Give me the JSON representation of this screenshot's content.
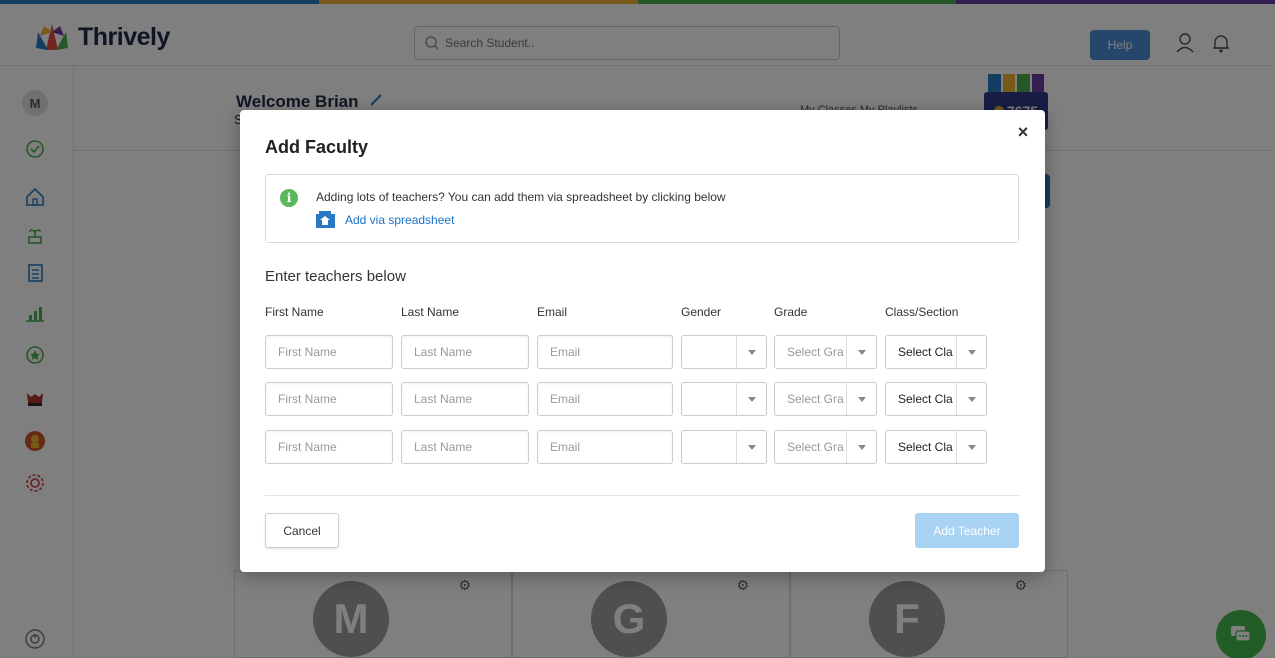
{
  "app": {
    "brand": "Thrively",
    "search_placeholder": "Search Student..",
    "help_label": "Help",
    "colors": {
      "rainbow": [
        "#2b79c2",
        "#f2b233",
        "#4caf50",
        "#6a3fa0"
      ],
      "accent": "#2b79c2"
    }
  },
  "sidebar": {
    "avatar_letter": "M",
    "icons": [
      "check-circle-icon",
      "home-icon",
      "plant-icon",
      "list-icon",
      "chart-icon",
      "star-badge-icon",
      "mascot-icon",
      "character-icon",
      "settings-icon",
      "power-icon"
    ]
  },
  "background": {
    "welcome": "Welcome Brian",
    "subtitle_initial": "S",
    "tabs": "My Classes    My Playlists",
    "points": "7675",
    "card_letters": [
      "M",
      "G",
      "F"
    ]
  },
  "modal": {
    "title": "Add Faculty",
    "close_glyph": "×",
    "info_text": "Adding lots of teachers? You can add them via spreadsheet by clicking below",
    "spreadsheet_link": "Add via spreadsheet",
    "section_heading": "Enter teachers below",
    "columns": {
      "first_name": "First Name",
      "last_name": "Last Name",
      "email": "Email",
      "gender": "Gender",
      "grade": "Grade",
      "class_section": "Class/Section"
    },
    "placeholders": {
      "first_name": "First Name",
      "last_name": "Last Name",
      "email": "Email"
    },
    "rows": [
      {
        "gender": "",
        "grade": "Select Gra",
        "class": "Select Cla"
      },
      {
        "gender": "",
        "grade": "Select Gra",
        "class": "Select Cla"
      },
      {
        "gender": "",
        "grade": "Select Gra",
        "class": "Select Cla"
      }
    ],
    "cancel_label": "Cancel",
    "submit_label": "Add Teacher"
  }
}
